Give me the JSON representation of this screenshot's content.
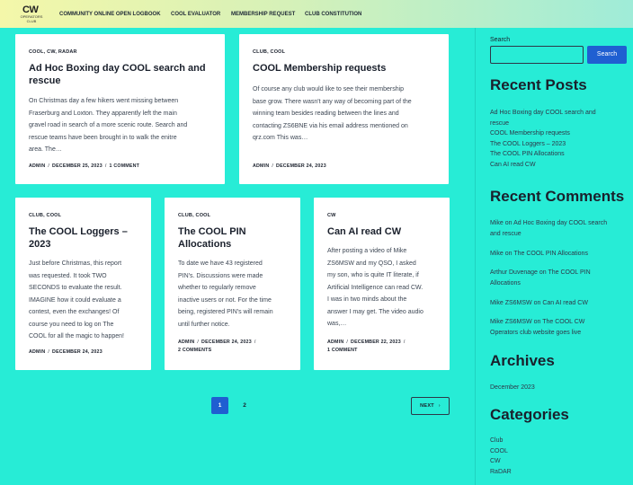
{
  "header": {
    "logo": {
      "mark": "CW",
      "sub_lines": [
        "OPERATORS",
        "CLUB"
      ]
    },
    "nav": [
      {
        "label": "COMMUNITY ONLINE OPEN LOGBOOK"
      },
      {
        "label": "COOL EVALUATOR"
      },
      {
        "label": "MEMBERSHIP REQUEST"
      },
      {
        "label": "CLUB CONSTITUTION"
      }
    ]
  },
  "posts": [
    {
      "categories": "COOL, CW, RADAR",
      "title_lines": [
        "Ad Hoc Boxing day COOL search and",
        "rescue"
      ],
      "excerpt_lines": [
        "On Christmas day a few hikers went missing between",
        "Fraserburg and Loxton. They apparently left the main",
        "gravel road in search of a more scenic route. Search and",
        "rescue teams have been brought in to walk the enitre",
        "area. The…"
      ],
      "author": "ADMIN",
      "date": "DECEMBER 25, 2023",
      "comments": "1 COMMENT"
    },
    {
      "categories": "CLUB, COOL",
      "title_lines": [
        "COOL Membership requests"
      ],
      "excerpt_lines": [
        "Of course any club would like to see their membership",
        "base grow. There wasn't any way of becoming part of the",
        "winning team besides reading between the lines and",
        "contacting ZS6BNE via his email address mentioned on",
        "qrz.com This was…"
      ],
      "author": "ADMIN",
      "date": "DECEMBER 24, 2023"
    },
    {
      "categories": "CLUB, COOL",
      "title_lines": [
        "The COOL Loggers –",
        "2023"
      ],
      "excerpt_lines": [
        "Just before Christmas, this report",
        "was requested. It took TWO",
        "SECONDS to evaluate the result.",
        "IMAGINE how it could evaluate a",
        "contest, even the exchanges! Of",
        "course you need to log on The",
        "COOL for all the magic to happen!"
      ],
      "author": "ADMIN",
      "date": "DECEMBER 24, 2023"
    },
    {
      "categories": "CLUB, COOL",
      "title_lines": [
        "The COOL PIN",
        "Allocations"
      ],
      "excerpt_lines": [
        "To date we have 43 registered",
        "PIN's. Discussions were made",
        "whether to regularly remove",
        "inactive users or not. For the time",
        "being, registered PIN's will remain",
        "until further notice."
      ],
      "author": "ADMIN",
      "date": "DECEMBER 24, 2023",
      "comments": "2 COMMENTS"
    },
    {
      "categories": "CW",
      "title_lines": [
        "Can AI read CW"
      ],
      "excerpt_lines": [
        "After posting a video of Mike",
        "ZS6MSW and my QSO, I asked",
        "my son, who is quite IT literate, if",
        "Artificial Intelligence can read CW.",
        "I was in two minds about the",
        "answer I may get. The video audio",
        "was,…"
      ],
      "author": "ADMIN",
      "date": "DECEMBER 22, 2023",
      "comments": "1 COMMENT"
    }
  ],
  "pagination": {
    "current": "1",
    "other": "2",
    "next_label": "NEXT",
    "next_icon": "chevron-right-icon"
  },
  "sidebar": {
    "search_label": "Search",
    "search_value": "",
    "search_button": "Search",
    "recent_posts_heading": "Recent Posts",
    "recent_posts": [
      "Ad Hoc Boxing day COOL search and",
      "rescue",
      "COOL Membership requests",
      "The COOL Loggers – 2023",
      "The COOL PIN Allocations",
      "Can AI read CW"
    ],
    "recent_comments_heading": "Recent Comments",
    "recent_comments": [
      [
        "Mike on Ad Hoc Boxing day COOL search",
        "and rescue"
      ],
      [
        "Mike on The COOL PIN Allocations"
      ],
      [
        "Arthur Duvenage on The COOL PIN",
        "Allocations"
      ],
      [
        "Mike ZS6MSW on Can AI read CW"
      ],
      [
        "Mike ZS6MSW on The COOL CW",
        "Operators club website goes live"
      ]
    ],
    "archives_heading": "Archives",
    "archives": [
      "December 2023"
    ],
    "categories_heading": "Categories",
    "categories": [
      "Club",
      "COOL",
      "CW",
      "RaDAR"
    ]
  },
  "colors": {
    "background": "#27ecd6",
    "accent": "#1f5fd1",
    "card": "#ffffff"
  }
}
